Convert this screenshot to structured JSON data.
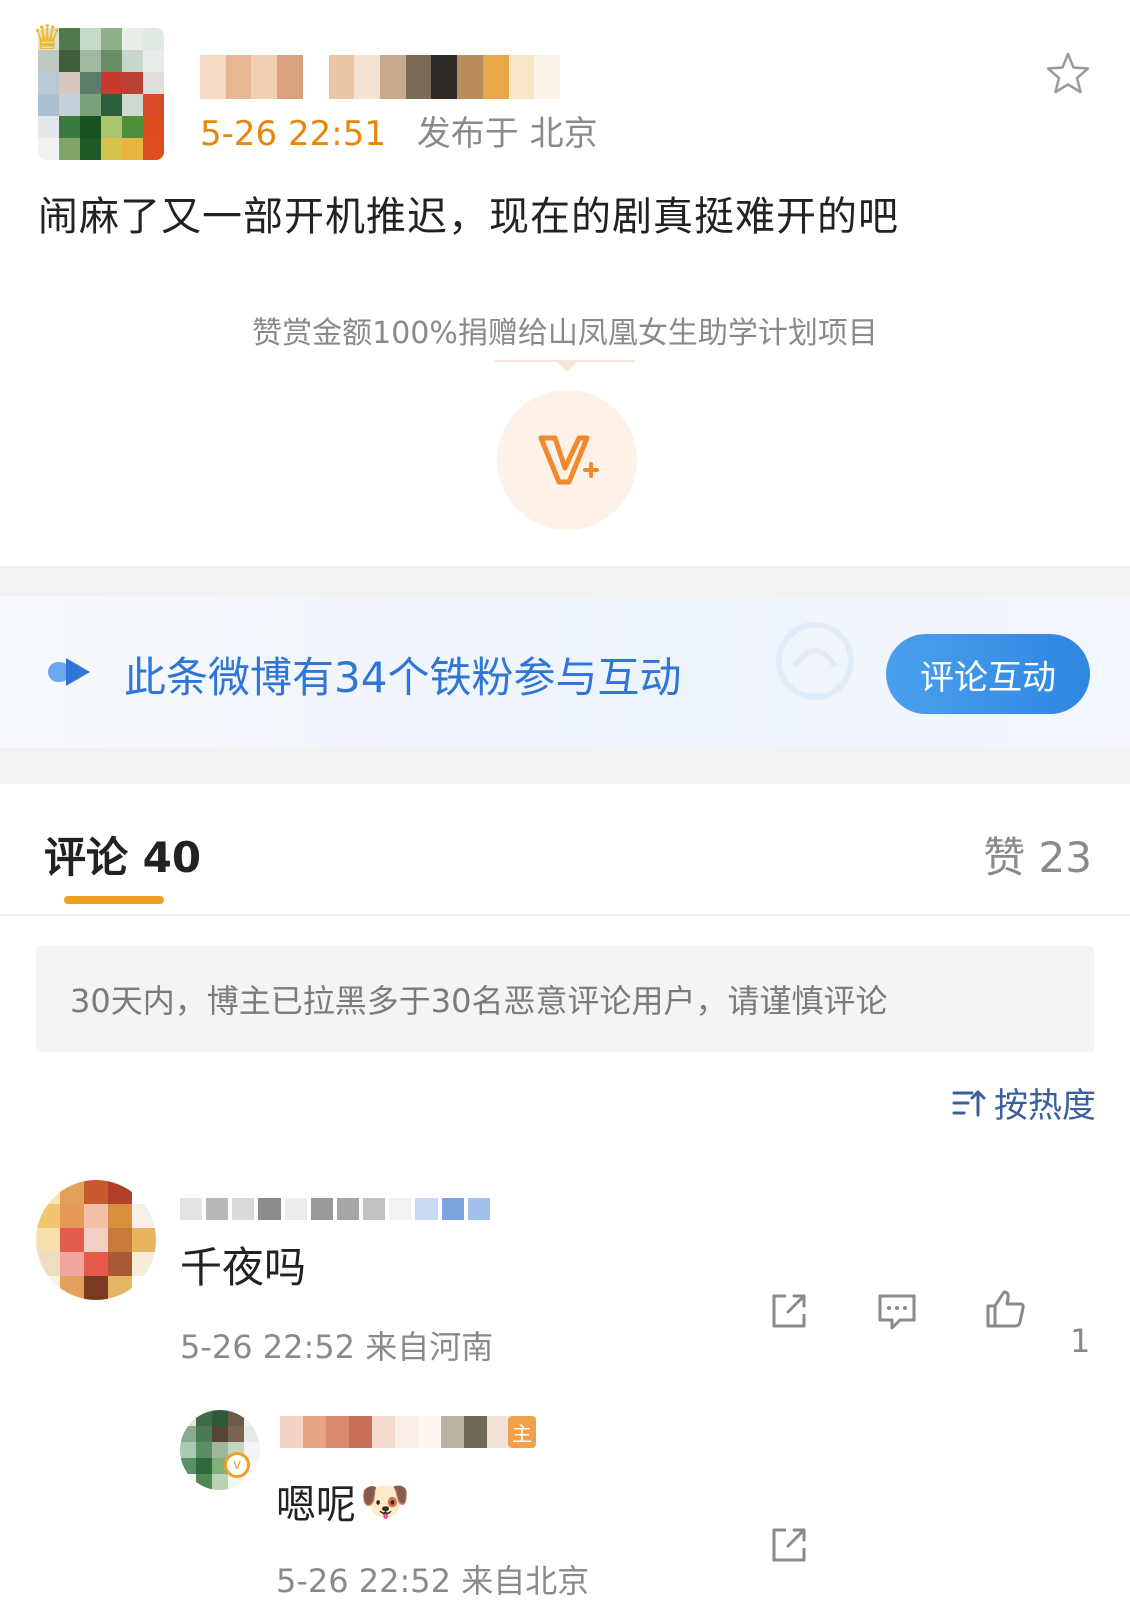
{
  "post": {
    "time": "5-26 22:51",
    "location": "发布于 北京",
    "text": "闹麻了又一部开机推迟，现在的剧真挺难开的吧",
    "donate_note": "赞赏金额100%捐赠给山凤凰女生助学计划项目",
    "favorite_icon": "star-outline-icon",
    "reward_icon": "v-plus-icon"
  },
  "banner": {
    "text": "此条微博有34个铁粉参与互动",
    "button": "评论互动",
    "accent": "#2f76d6"
  },
  "tabs": {
    "comments": "评论 40",
    "likes": "赞 23"
  },
  "notice": "30天内，博主已拉黑多于30名恶意评论用户，请谨慎评论",
  "sort": {
    "label": "按热度",
    "icon": "sort-icon"
  },
  "comment": {
    "text": "千夜吗",
    "meta": "5-26 22:52 来自河南",
    "like_count": "1"
  },
  "reply": {
    "owner_tag": "主",
    "text": "嗯呢",
    "emoji": "🐶",
    "meta": "5-26 22:52 来自北京"
  },
  "colors": {
    "orange": "#e8860c",
    "tab_underline": "#f0a020",
    "gray_text": "#8a8a8a",
    "link_blue": "#3b5f9e"
  }
}
